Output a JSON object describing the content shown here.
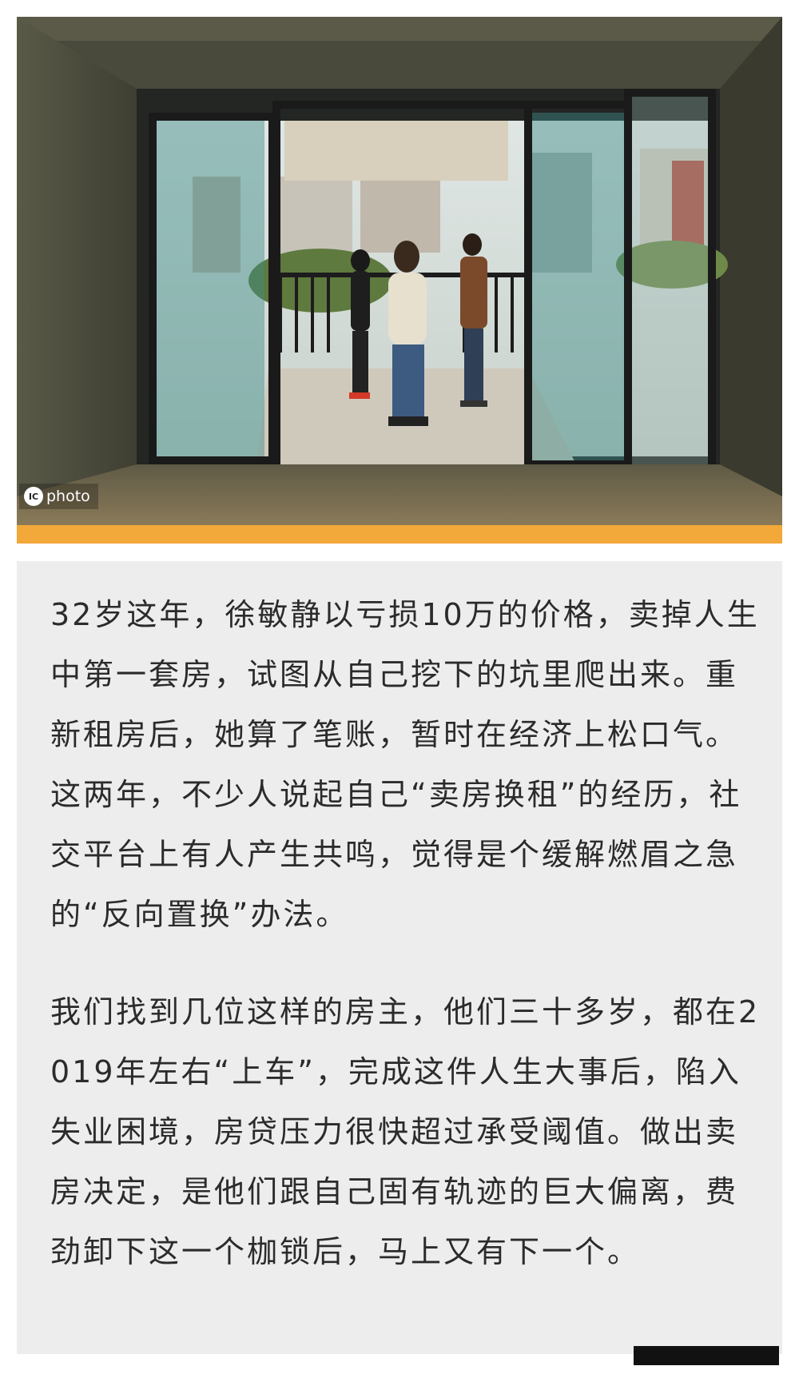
{
  "photo": {
    "watermark_text": "photo",
    "watermark_logo": "IC"
  },
  "colors": {
    "accent_bar": "#f3a83a",
    "card_background": "#ededed",
    "text": "#2b2b2b"
  },
  "article": {
    "paragraph_1": "32岁这年，徐敏静以亏损10万的价格，卖掉人生中第一套房，试图从自己挖下的坑里爬出来。重新租房后，她算了笔账，暂时在经济上松口气。这两年，不少人说起自己“卖房换租”的经历，社交平台上有人产生共鸣，觉得是个缓解燃眉之急的“反向置换”办法。",
    "paragraph_2": "我们找到几位这样的房主，他们三十多岁，都在2019年左右“上车”，完成这件人生大事后，陷入失业困境，房贷压力很快超过承受阈值。做出卖房决定，是他们跟自己固有轨迹的巨大偏离，费劲卸下这一个枷锁后，马上又有下一个。"
  }
}
